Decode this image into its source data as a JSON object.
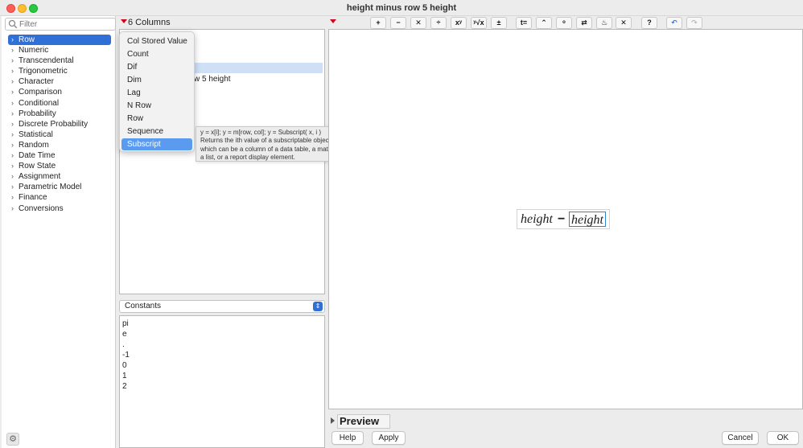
{
  "window": {
    "title": "height minus row 5 height"
  },
  "filter": {
    "placeholder": "Filter"
  },
  "categories": [
    {
      "label": "Row",
      "selected": true
    },
    {
      "label": "Numeric"
    },
    {
      "label": "Transcendental"
    },
    {
      "label": "Trigonometric"
    },
    {
      "label": "Character"
    },
    {
      "label": "Comparison"
    },
    {
      "label": "Conditional"
    },
    {
      "label": "Probability"
    },
    {
      "label": "Discrete Probability"
    },
    {
      "label": "Statistical"
    },
    {
      "label": "Random"
    },
    {
      "label": "Date Time"
    },
    {
      "label": "Row State"
    },
    {
      "label": "Assignment"
    },
    {
      "label": "Parametric Model"
    },
    {
      "label": "Finance"
    },
    {
      "label": "Conversions"
    }
  ],
  "columns": {
    "count_label": "6 Columns",
    "visible_row_fragment": "w 5 height"
  },
  "menu": {
    "items": [
      "Col Stored Value",
      "Count",
      "Dif",
      "Dim",
      "Lag",
      "N Row",
      "Row",
      "Sequence",
      "Subscript"
    ],
    "active_item": "Subscript"
  },
  "tooltip": {
    "lines": [
      "y = x[i]; y = m[row, col]; y = Subscript( x, i )",
      "Returns the ith value of a subscriptable object,",
      "which can be a column of a data table, a matrix,",
      "a list, or a report display element."
    ]
  },
  "constants": {
    "selector_label": "Constants",
    "items": [
      "pi",
      "e",
      ".",
      "-1",
      "0",
      "1",
      "2"
    ]
  },
  "toolbar": {
    "buttons": [
      {
        "icon": "plus-icon",
        "glyph": "+"
      },
      {
        "icon": "minus-icon",
        "glyph": "−"
      },
      {
        "icon": "multiply-icon",
        "glyph": "✕"
      },
      {
        "icon": "divide-icon",
        "glyph": "÷"
      },
      {
        "icon": "power-icon",
        "glyph": "xʸ"
      },
      {
        "icon": "root-icon",
        "glyph": "ʸ√x"
      },
      {
        "icon": "plus-minus-icon",
        "glyph": "±"
      },
      {
        "icon": "assign-icon",
        "glyph": "t="
      },
      {
        "icon": "caret-up-icon",
        "glyph": "⌃"
      },
      {
        "icon": "local-variable-icon",
        "glyph": "ᵒ"
      },
      {
        "icon": "swap-icon",
        "glyph": "⇄"
      },
      {
        "icon": "peel-icon",
        "glyph": "♨"
      },
      {
        "icon": "delete-icon",
        "glyph": "✕"
      },
      {
        "icon": "help-icon",
        "glyph": "?"
      },
      {
        "icon": "undo-icon",
        "glyph": "↶"
      },
      {
        "icon": "redo-icon",
        "glyph": "↷"
      }
    ]
  },
  "formula": {
    "left_term": "height",
    "operator": "−",
    "right_term": "height"
  },
  "preview": {
    "label": "Preview"
  },
  "buttons": {
    "help": "Help",
    "apply": "Apply",
    "cancel": "Cancel",
    "ok": "OK"
  }
}
